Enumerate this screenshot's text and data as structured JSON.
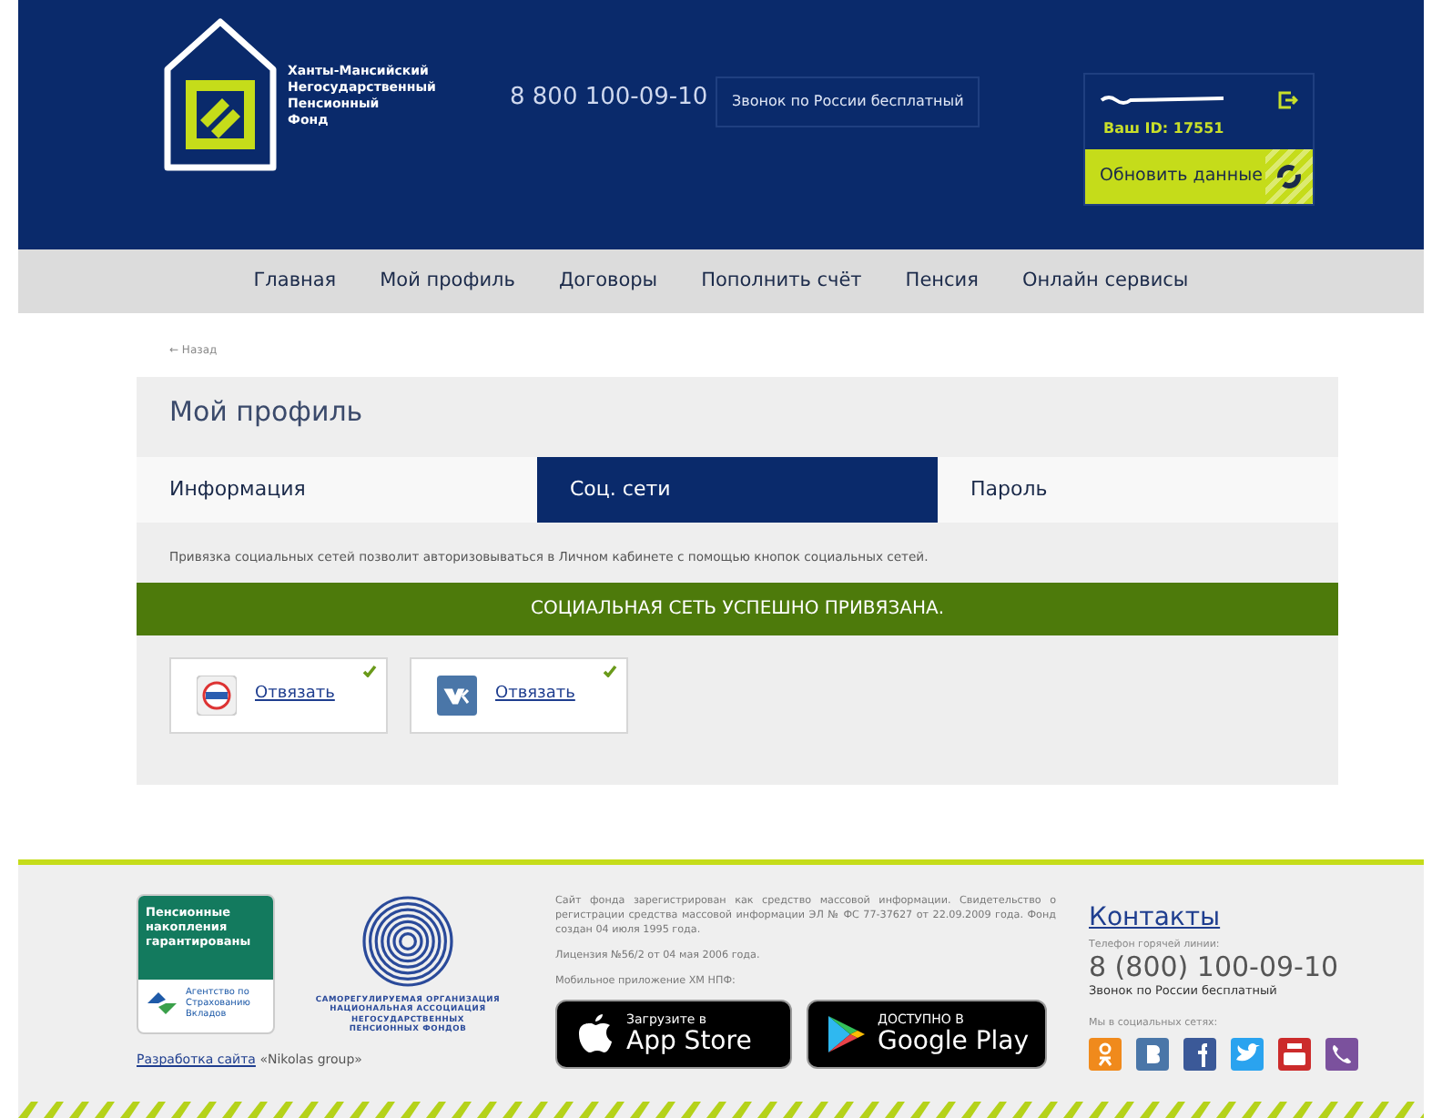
{
  "header": {
    "logo_lines": [
      "Ханты-Мансийский",
      "Негосударственный",
      "Пенсионный",
      "Фонд"
    ],
    "phone": "8 800 100-09-10",
    "phone_note": "Звонок по России бесплатный",
    "user": {
      "id_label": "Ваш ID: 17551"
    },
    "refresh_button": "Обновить данные"
  },
  "nav": {
    "items": [
      "Главная",
      "Мой профиль",
      "Договоры",
      "Пополнить счёт",
      "Пенсия",
      "Онлайн сервисы"
    ]
  },
  "back_link": "← Назад",
  "profile": {
    "title": "Мой профиль",
    "tabs": [
      {
        "label": "Информация",
        "selected": false
      },
      {
        "label": "Соц. сети",
        "selected": true
      },
      {
        "label": "Пароль",
        "selected": false
      }
    ],
    "description": "Привязка социальных сетей позволит авторизовываться в Личном кабинете с помощью кнопок социальных сетей.",
    "alert": "СОЦИАЛЬНАЯ СЕТЬ УСПЕШНО ПРИВЯЗАНА.",
    "socials": [
      {
        "kind": "gosuslugi",
        "action": "Отвязать",
        "linked": true
      },
      {
        "kind": "vk",
        "action": "Отвязать",
        "linked": true
      }
    ]
  },
  "footer": {
    "guarantee_badge": {
      "title": "Пенсионные накопления гарантированы",
      "agency": [
        "Агентство по",
        "Страхованию",
        "Вкладов"
      ]
    },
    "association": [
      "САМОРЕГУЛИРУЕМАЯ ОРГАНИЗАЦИЯ",
      "НАЦИОНАЛЬНАЯ АССОЦИАЦИЯ",
      "НЕГОСУДАРСТВЕННЫХ",
      "ПЕНСИОННЫХ ФОНДОВ"
    ],
    "developer_link": "Разработка сайта",
    "developer_name": "«Nikolas group»",
    "legal": [
      "Сайт фонда зарегистрирован как средство массовой информации. Свидетельство о регистрации средства массовой информации ЭЛ № ФС 77-37627 от 22.09.2009 года. Фонд создан 04 июля 1995 года.",
      "Лицензия №56/2 от 04 мая 2006 года."
    ],
    "mobile_label": "Мобильное приложение ХМ НПФ:",
    "stores": [
      {
        "kind": "apple",
        "small": "Загрузите в",
        "big": "App Store"
      },
      {
        "kind": "google",
        "small": "ДОСТУПНО В",
        "big": "Google Play"
      }
    ],
    "contacts_title": "Контакты",
    "hotline_label": "Телефон горячей линии:",
    "phone": "8 (800) 100-09-10",
    "phone_note": "Звонок по России бесплатный",
    "social_label": "Мы в социальных сетях:"
  }
}
